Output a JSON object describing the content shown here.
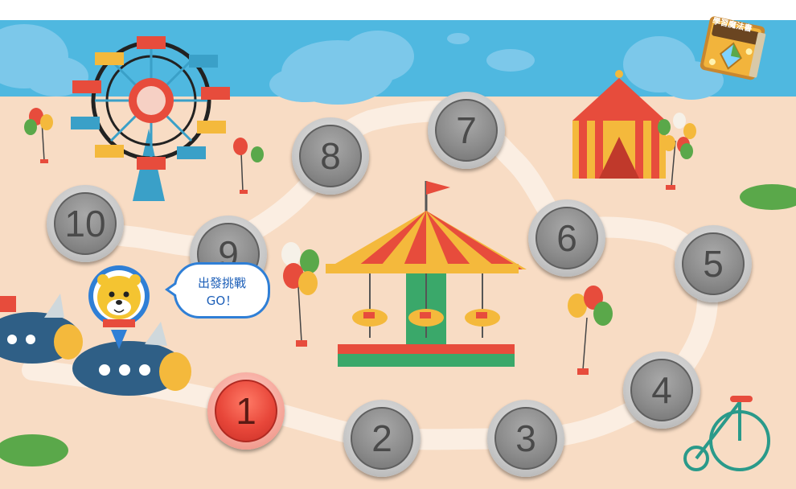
{
  "game": {
    "book_label": "學習魔法書",
    "speech_line1": "出發挑戰",
    "speech_line2": "GO！",
    "current_level": 1
  },
  "levels": [
    {
      "id": 1,
      "label": "1",
      "state": "active"
    },
    {
      "id": 2,
      "label": "2",
      "state": "locked"
    },
    {
      "id": 3,
      "label": "3",
      "state": "locked"
    },
    {
      "id": 4,
      "label": "4",
      "state": "locked"
    },
    {
      "id": 5,
      "label": "5",
      "state": "locked"
    },
    {
      "id": 6,
      "label": "6",
      "state": "locked"
    },
    {
      "id": 7,
      "label": "7",
      "state": "locked"
    },
    {
      "id": 8,
      "label": "8",
      "state": "locked"
    },
    {
      "id": 9,
      "label": "9",
      "state": "locked"
    },
    {
      "id": 10,
      "label": "10",
      "state": "locked"
    }
  ],
  "colors": {
    "sky": "#4fb8e0",
    "ground": "#f8dcc4",
    "path": "#fbeee2",
    "active_level": "#e8473a",
    "locked_level": "#8c8c8c",
    "speech_border": "#2f7fd6"
  }
}
